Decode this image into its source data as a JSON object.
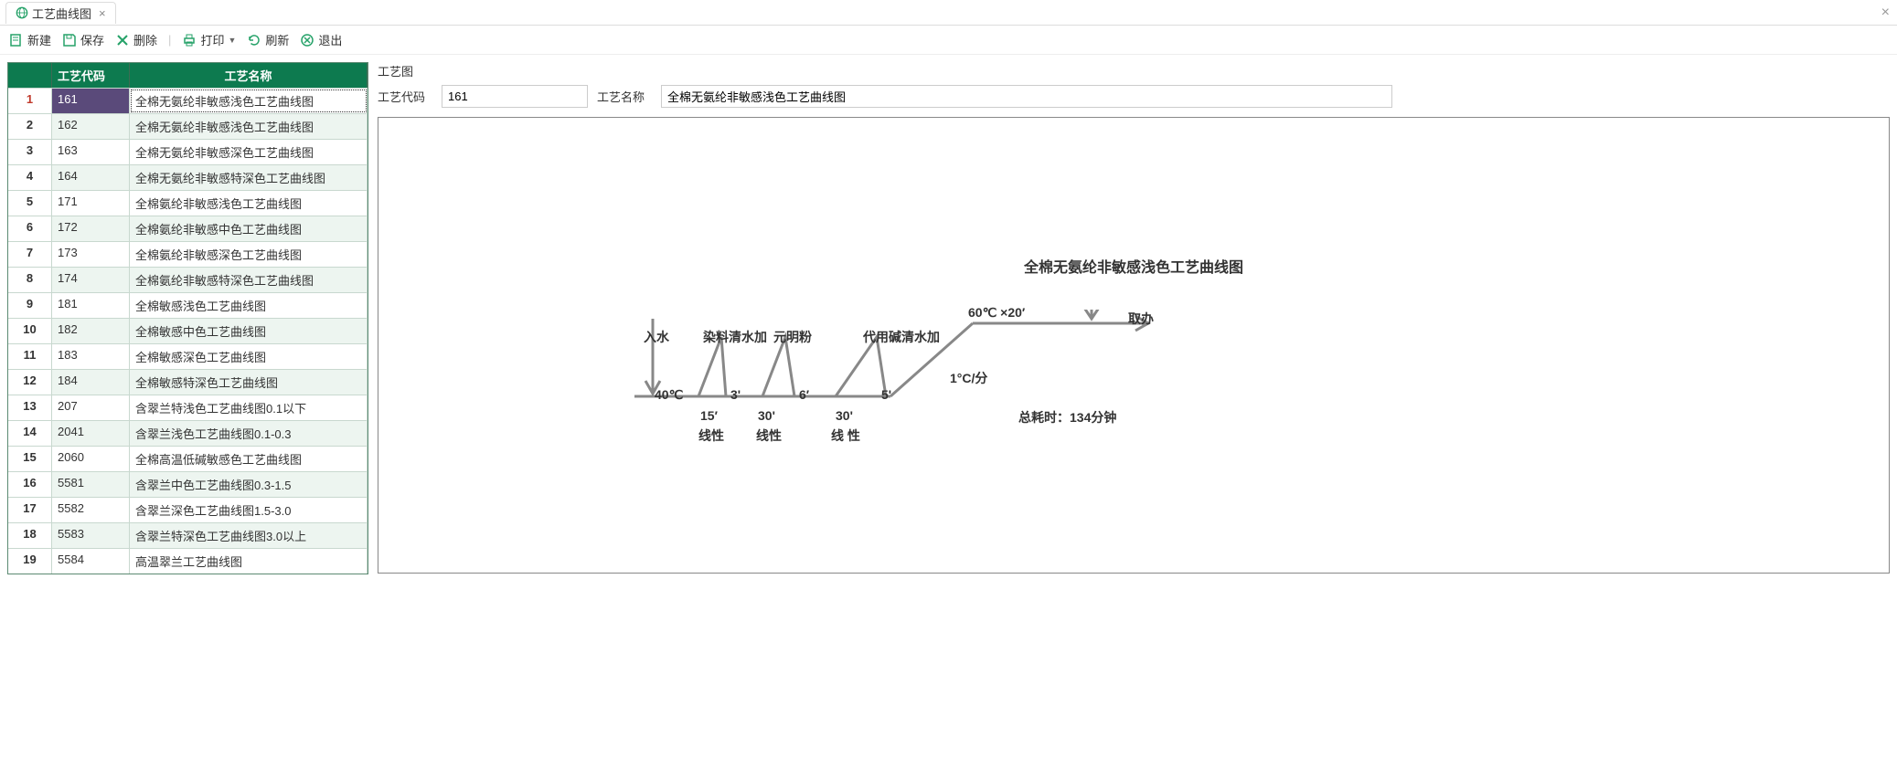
{
  "tab": {
    "title": "工艺曲线图"
  },
  "toolbar": {
    "new": "新建",
    "save": "保存",
    "delete": "删除",
    "print": "打印",
    "refresh": "刷新",
    "exit": "退出"
  },
  "grid": {
    "headers": {
      "code": "工艺代码",
      "name": "工艺名称"
    },
    "rows": [
      {
        "n": "1",
        "code": "161",
        "name": "全棉无氨纶非敏感浅色工艺曲线图",
        "sel": true
      },
      {
        "n": "2",
        "code": "162",
        "name": "全棉无氨纶非敏感浅色工艺曲线图"
      },
      {
        "n": "3",
        "code": "163",
        "name": "全棉无氨纶非敏感深色工艺曲线图"
      },
      {
        "n": "4",
        "code": "164",
        "name": "全棉无氨纶非敏感特深色工艺曲线图"
      },
      {
        "n": "5",
        "code": "171",
        "name": "全棉氨纶非敏感浅色工艺曲线图"
      },
      {
        "n": "6",
        "code": "172",
        "name": "全棉氨纶非敏感中色工艺曲线图"
      },
      {
        "n": "7",
        "code": "173",
        "name": "全棉氨纶非敏感深色工艺曲线图"
      },
      {
        "n": "8",
        "code": "174",
        "name": "全棉氨纶非敏感特深色工艺曲线图"
      },
      {
        "n": "9",
        "code": "181",
        "name": "全棉敏感浅色工艺曲线图"
      },
      {
        "n": "10",
        "code": "182",
        "name": "全棉敏感中色工艺曲线图"
      },
      {
        "n": "11",
        "code": "183",
        "name": "全棉敏感深色工艺曲线图"
      },
      {
        "n": "12",
        "code": "184",
        "name": "全棉敏感特深色工艺曲线图"
      },
      {
        "n": "13",
        "code": "207",
        "name": "含翠兰特浅色工艺曲线图0.1以下"
      },
      {
        "n": "14",
        "code": "2041",
        "name": "含翠兰浅色工艺曲线图0.1-0.3"
      },
      {
        "n": "15",
        "code": "2060",
        "name": "全棉高温低碱敏感色工艺曲线图"
      },
      {
        "n": "16",
        "code": "5581",
        "name": "含翠兰中色工艺曲线图0.3-1.5"
      },
      {
        "n": "17",
        "code": "5582",
        "name": "含翠兰深色工艺曲线图1.5-3.0"
      },
      {
        "n": "18",
        "code": "5583",
        "name": "含翠兰特深色工艺曲线图3.0以上"
      },
      {
        "n": "19",
        "code": "5584",
        "name": "高温翠兰工艺曲线图"
      }
    ]
  },
  "detail": {
    "section_label": "工艺图",
    "code_label": "工艺代码",
    "code_value": "161",
    "name_label": "工艺名称",
    "name_value": "全棉无氨纶非敏感浅色工艺曲线图"
  },
  "chart_data": {
    "type": "process-curve",
    "title": "全棉无氨纶非敏感浅色工艺曲线图",
    "start_temp": "40℃",
    "hold_temp": "60℃ ×20′",
    "ramp_rate": "1°C/分",
    "total_time_label": "总耗时：134分钟",
    "end_action": "取办",
    "steps": [
      {
        "top": "入水",
        "bottom": ""
      },
      {
        "top": "染料清水加",
        "bottom": "3'",
        "after": "15′",
        "mode": "线性"
      },
      {
        "top": "元明粉",
        "bottom": "6′",
        "after": "30'",
        "mode": "线性"
      },
      {
        "top": "代用碱清水加",
        "bottom": "5'",
        "after": "30'",
        "mode": "线 性"
      }
    ]
  }
}
